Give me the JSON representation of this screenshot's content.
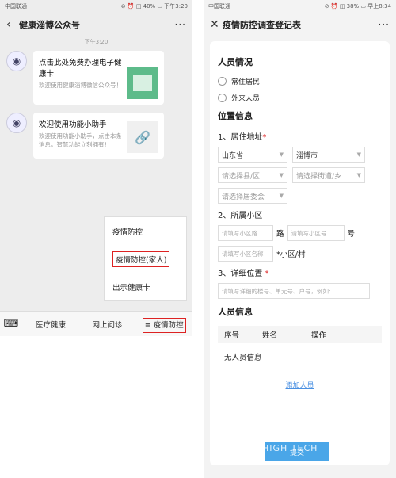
{
  "left": {
    "status": {
      "carrier": "中国联通",
      "right": "⊘ ⏰ ◫ 40% ▭ 下午3:20"
    },
    "nav": {
      "back": "‹",
      "title": "健康淄博公众号",
      "more": "···"
    },
    "time_tag": "下午3:20",
    "messages": [
      {
        "title": "点击此处免费办理电子健康卡",
        "desc": "欢迎使用健康淄博微信公众号！"
      },
      {
        "title": "欢迎使用功能小助手",
        "desc": "欢迎使用功能小助手，点击本条消息，智慧功能立刻拥有！"
      }
    ],
    "popup": [
      "疫情防控",
      "疫情防控(家人)",
      "出示健康卡"
    ],
    "bottom": {
      "keyboard": "⌨",
      "tabs": [
        "医疗健康",
        "网上问诊",
        "≡ 疫情防控"
      ]
    }
  },
  "right": {
    "status": {
      "carrier": "中国联通",
      "right": "⊘ ⏰ ◫ 38% ▭ 早上8:34"
    },
    "nav": {
      "close": "✕",
      "title": "疫情防控调查登记表",
      "more": "···"
    },
    "form": {
      "person_section": "人员情况",
      "radios": [
        "常住居民",
        "外来人员"
      ],
      "location_section": "位置信息",
      "address_label": "1、居住地址",
      "province": "山东省",
      "city": "淄博市",
      "county_ph": "请选择县/区",
      "street_ph": "请选择街道/乡",
      "committee_ph": "请选择居委会",
      "community_label": "2、所属小区",
      "road_ph": "请填写小区路",
      "road_suffix": "路",
      "num_ph": "请填写小区号",
      "num_suffix": "号",
      "name_ph": "请填写小区名称",
      "name_suffix": "*小区/村",
      "detail_label": "3、详细位置",
      "detail_ph": "请填写详细的楼号、单元号、户号，例如:",
      "people_section": "人员信息",
      "table_headers": [
        "序号",
        "姓名",
        "操作"
      ],
      "empty": "无人员信息",
      "add": "添加人员",
      "submit": "提交"
    },
    "watermark": "HIGH TECH"
  }
}
